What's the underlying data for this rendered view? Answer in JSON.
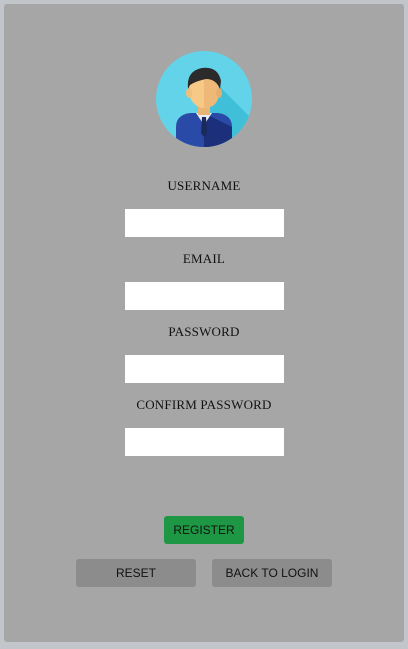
{
  "avatar": {
    "icon": "user-avatar-icon",
    "circle_color": "#63d3ea",
    "suit_color": "#1f3a93",
    "hair_color": "#2b2b2b",
    "skin_color": "#f6c987"
  },
  "form": {
    "username": {
      "label": "USERNAME",
      "value": ""
    },
    "email": {
      "label": "EMAIL",
      "value": ""
    },
    "password": {
      "label": "PASSWORD",
      "value": ""
    },
    "confirm_password": {
      "label": "CONFIRM PASSWORD",
      "value": ""
    }
  },
  "buttons": {
    "register": "REGISTER",
    "reset": "RESET",
    "back_to_login": "BACK TO LOGIN"
  },
  "colors": {
    "register_button": "#1e9744",
    "secondary_button": "#8c8c8c",
    "panel": "#a6a6a6"
  }
}
